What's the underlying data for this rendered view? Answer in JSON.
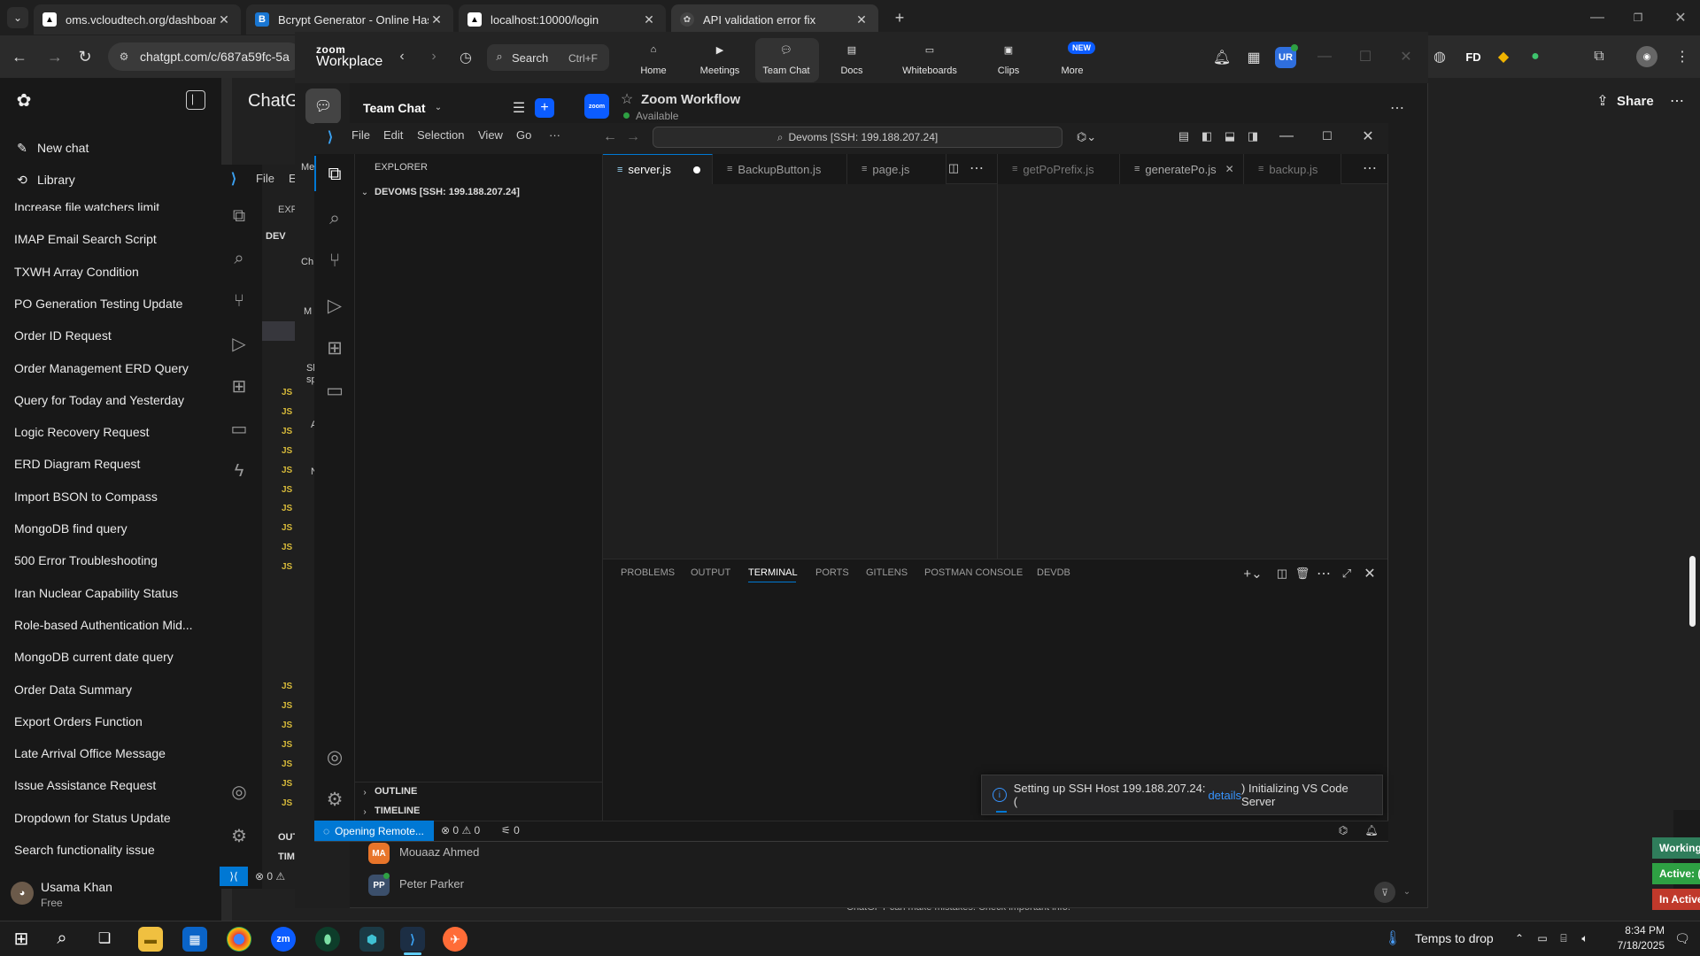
{
  "browser": {
    "tabs": [
      {
        "title": "oms.vcloudtech.org/dashboard"
      },
      {
        "title": "Bcrypt Generator - Online Hash"
      },
      {
        "title": "localhost:10000/login"
      },
      {
        "title": "API validation error fix"
      }
    ],
    "url": "chatgpt.com/c/687a59fc-5a"
  },
  "chatgpt": {
    "new_chat": "New chat",
    "library": "Library",
    "partial_title": "ChatG",
    "share": "Share",
    "history": [
      "Increase file watchers limit",
      "IMAP Email Search Script",
      "TXWH Array Condition",
      "PO Generation Testing Update",
      "Order ID Request",
      "Order Management ERD Query",
      "Query for Today and Yesterday",
      "Logic Recovery Request",
      "ERD Diagram Request",
      "Import BSON to Compass",
      "MongoDB find query",
      "500 Error Troubleshooting",
      "Iran Nuclear Capability Status",
      "Role-based Authentication Mid...",
      "MongoDB current date query",
      "Order Data Summary",
      "Export Orders Function",
      "Late Arrival Office Message",
      "Issue Assistance Request",
      "Dropdown for Status Update",
      "Search functionality issue"
    ],
    "user": {
      "name": "Usama Khan",
      "plan": "Free"
    },
    "disclaimer": "ChatGPT can make mistakes. Check important info."
  },
  "zoom": {
    "brand_top": "zoom",
    "brand_bottom": "Workplace",
    "search": "Search",
    "search_shortcut": "Ctrl+F",
    "nav": [
      "Home",
      "Meetings",
      "Team Chat",
      "Docs",
      "Whiteboards",
      "Clips",
      "More"
    ],
    "new_badge": "NEW",
    "avatar": "UR",
    "team_chat_title": "Team Chat",
    "channel": "Zoom Workflow",
    "channel_status": "Available",
    "channel_logo": "zoom",
    "contacts": [
      {
        "initials": "MA",
        "name": "Mouaaz Ahmed"
      },
      {
        "initials": "PP",
        "name": "Peter Parker"
      }
    ],
    "side_labels": [
      "Me",
      "Ch",
      "M",
      "Sl",
      "sp",
      "A",
      "N"
    ]
  },
  "vscode_back": {
    "menu_file": "File",
    "menu_e": "E",
    "explorer": "EXP",
    "root": "DEV",
    "outline": "OUT",
    "timeline": "TIM",
    "status": "⊗ 0 ⚠"
  },
  "vscode": {
    "menu": [
      "File",
      "Edit",
      "Selection",
      "View",
      "Go",
      "···"
    ],
    "command_center": "Devoms [SSH: 199.188.207.24]",
    "explorer_title": "EXPLORER",
    "root_folder": "DEVOMS [SSH: 199.188.207.24]",
    "outline": "OUTLINE",
    "timeline": "TIMELINE",
    "tabs_left": [
      "server.js",
      "BackupButton.js",
      "page.js"
    ],
    "tabs_right": [
      "getPoPrefix.js",
      "generatePo.js",
      "backup.js"
    ],
    "panel_tabs": [
      "PROBLEMS",
      "OUTPUT",
      "TERMINAL",
      "PORTS",
      "GITLENS",
      "POSTMAN CONSOLE",
      "DEVDB"
    ],
    "status_remote": "Opening Remote...",
    "status_errors": "0",
    "status_warnings": "0",
    "status_ports": "0",
    "toast_prefix": "Setting up SSH Host 199.188.207.24: (",
    "toast_link": "details",
    "toast_suffix": ") Initializing VS Code Server"
  },
  "right_badges": [
    "Working",
    "Active: (",
    "In Active"
  ],
  "taskbar": {
    "weather": "Temps to drop",
    "time": "8:34 PM",
    "date": "7/18/2025"
  },
  "colors": {
    "accent": "#0078d4",
    "zoom_blue": "#0b5cff",
    "badge_green": "#2ea043",
    "badge_red": "#c0392b"
  }
}
